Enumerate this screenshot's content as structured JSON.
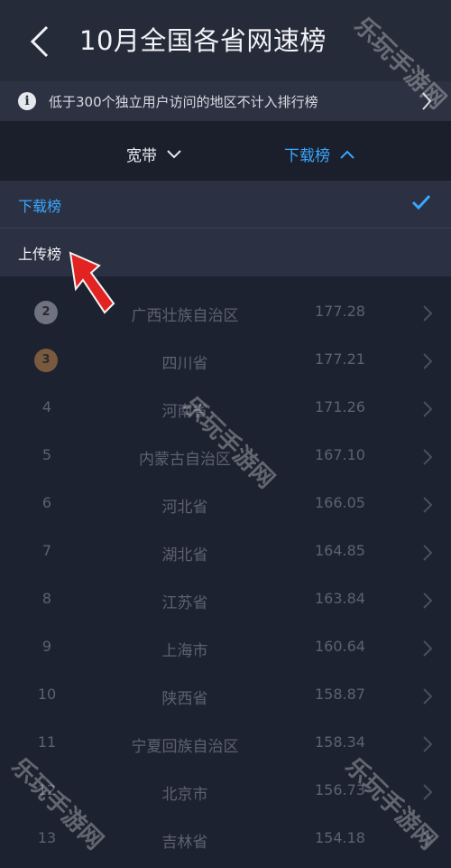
{
  "header": {
    "title": "10月全国各省网速榜"
  },
  "notice": {
    "icon_char": "i",
    "text": "低于300个独立用户访问的地区不计入排行榜"
  },
  "filters": {
    "type_label": "宽带",
    "rank_label": "下载榜"
  },
  "dropdown": {
    "items": [
      {
        "label": "下载榜",
        "selected": true
      },
      {
        "label": "上传榜",
        "selected": false
      }
    ]
  },
  "rows": [
    {
      "rank": "2",
      "region": "广西壮族自治区",
      "speed": "177.28",
      "medal": "silver"
    },
    {
      "rank": "3",
      "region": "四川省",
      "speed": "177.21",
      "medal": "bronze"
    },
    {
      "rank": "4",
      "region": "河南省",
      "speed": "171.26"
    },
    {
      "rank": "5",
      "region": "内蒙古自治区",
      "speed": "167.10"
    },
    {
      "rank": "6",
      "region": "河北省",
      "speed": "166.05"
    },
    {
      "rank": "7",
      "region": "湖北省",
      "speed": "164.85"
    },
    {
      "rank": "8",
      "region": "江苏省",
      "speed": "163.84"
    },
    {
      "rank": "9",
      "region": "上海市",
      "speed": "160.64"
    },
    {
      "rank": "10",
      "region": "陕西省",
      "speed": "158.87"
    },
    {
      "rank": "11",
      "region": "宁夏回族自治区",
      "speed": "158.34"
    },
    {
      "rank": "12",
      "region": "北京市",
      "speed": "156.73"
    },
    {
      "rank": "13",
      "region": "吉林省",
      "speed": "154.18"
    }
  ],
  "watermark": "乐玩手游网",
  "colors": {
    "accent": "#39a7ff",
    "background": "#1d2230",
    "pointer": "#e32222"
  }
}
